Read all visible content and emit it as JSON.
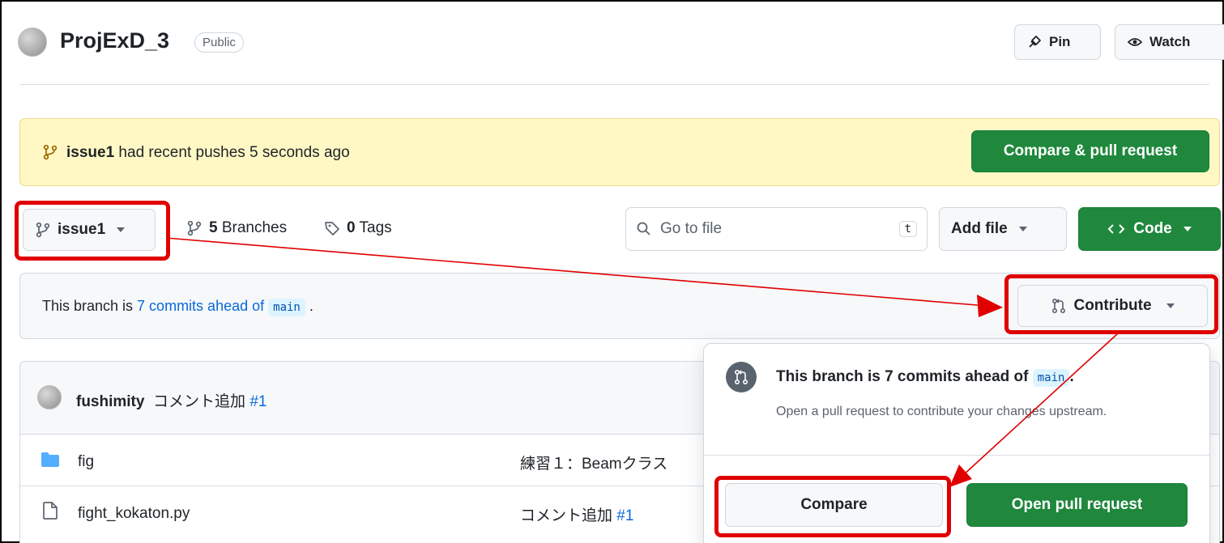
{
  "repo": {
    "name": "ProjExD_3",
    "visibility": "Public"
  },
  "header_actions": {
    "pin": "Pin",
    "watch": "Watch"
  },
  "banner": {
    "branch": "issue1",
    "text": " had recent pushes 5 seconds ago",
    "compare_pr": "Compare & pull request"
  },
  "toolbar": {
    "branch_selector": "issue1",
    "branches_count": "5",
    "branches_label": "Branches",
    "tags_count": "0",
    "tags_label": "Tags",
    "search_placeholder": "Go to file",
    "search_shortcut": "t",
    "add_file": "Add file",
    "code": "Code"
  },
  "ahead": {
    "prefix": "This branch is ",
    "link": "7 commits ahead of",
    "base": "main",
    "suffix": ".",
    "contribute": "Contribute"
  },
  "commit": {
    "author": "fushimity",
    "message": "コメント追加",
    "pr": "#1"
  },
  "files": [
    {
      "name": "fig",
      "type": "folder",
      "message": "練習１：Beamクラス",
      "pr": ""
    },
    {
      "name": "fight_kokaton.py",
      "type": "file",
      "message": "コメント追加",
      "pr": "#1"
    }
  ],
  "popover": {
    "title_prefix": "This branch is 7 commits ahead of ",
    "title_base": "main",
    "title_suffix": ".",
    "subtitle": "Open a pull request to contribute your changes upstream.",
    "compare": "Compare",
    "open_pr": "Open pull request"
  },
  "colors": {
    "accent_green": "#1f883d",
    "annotation_red": "#e00000",
    "link_blue": "#0969da"
  }
}
